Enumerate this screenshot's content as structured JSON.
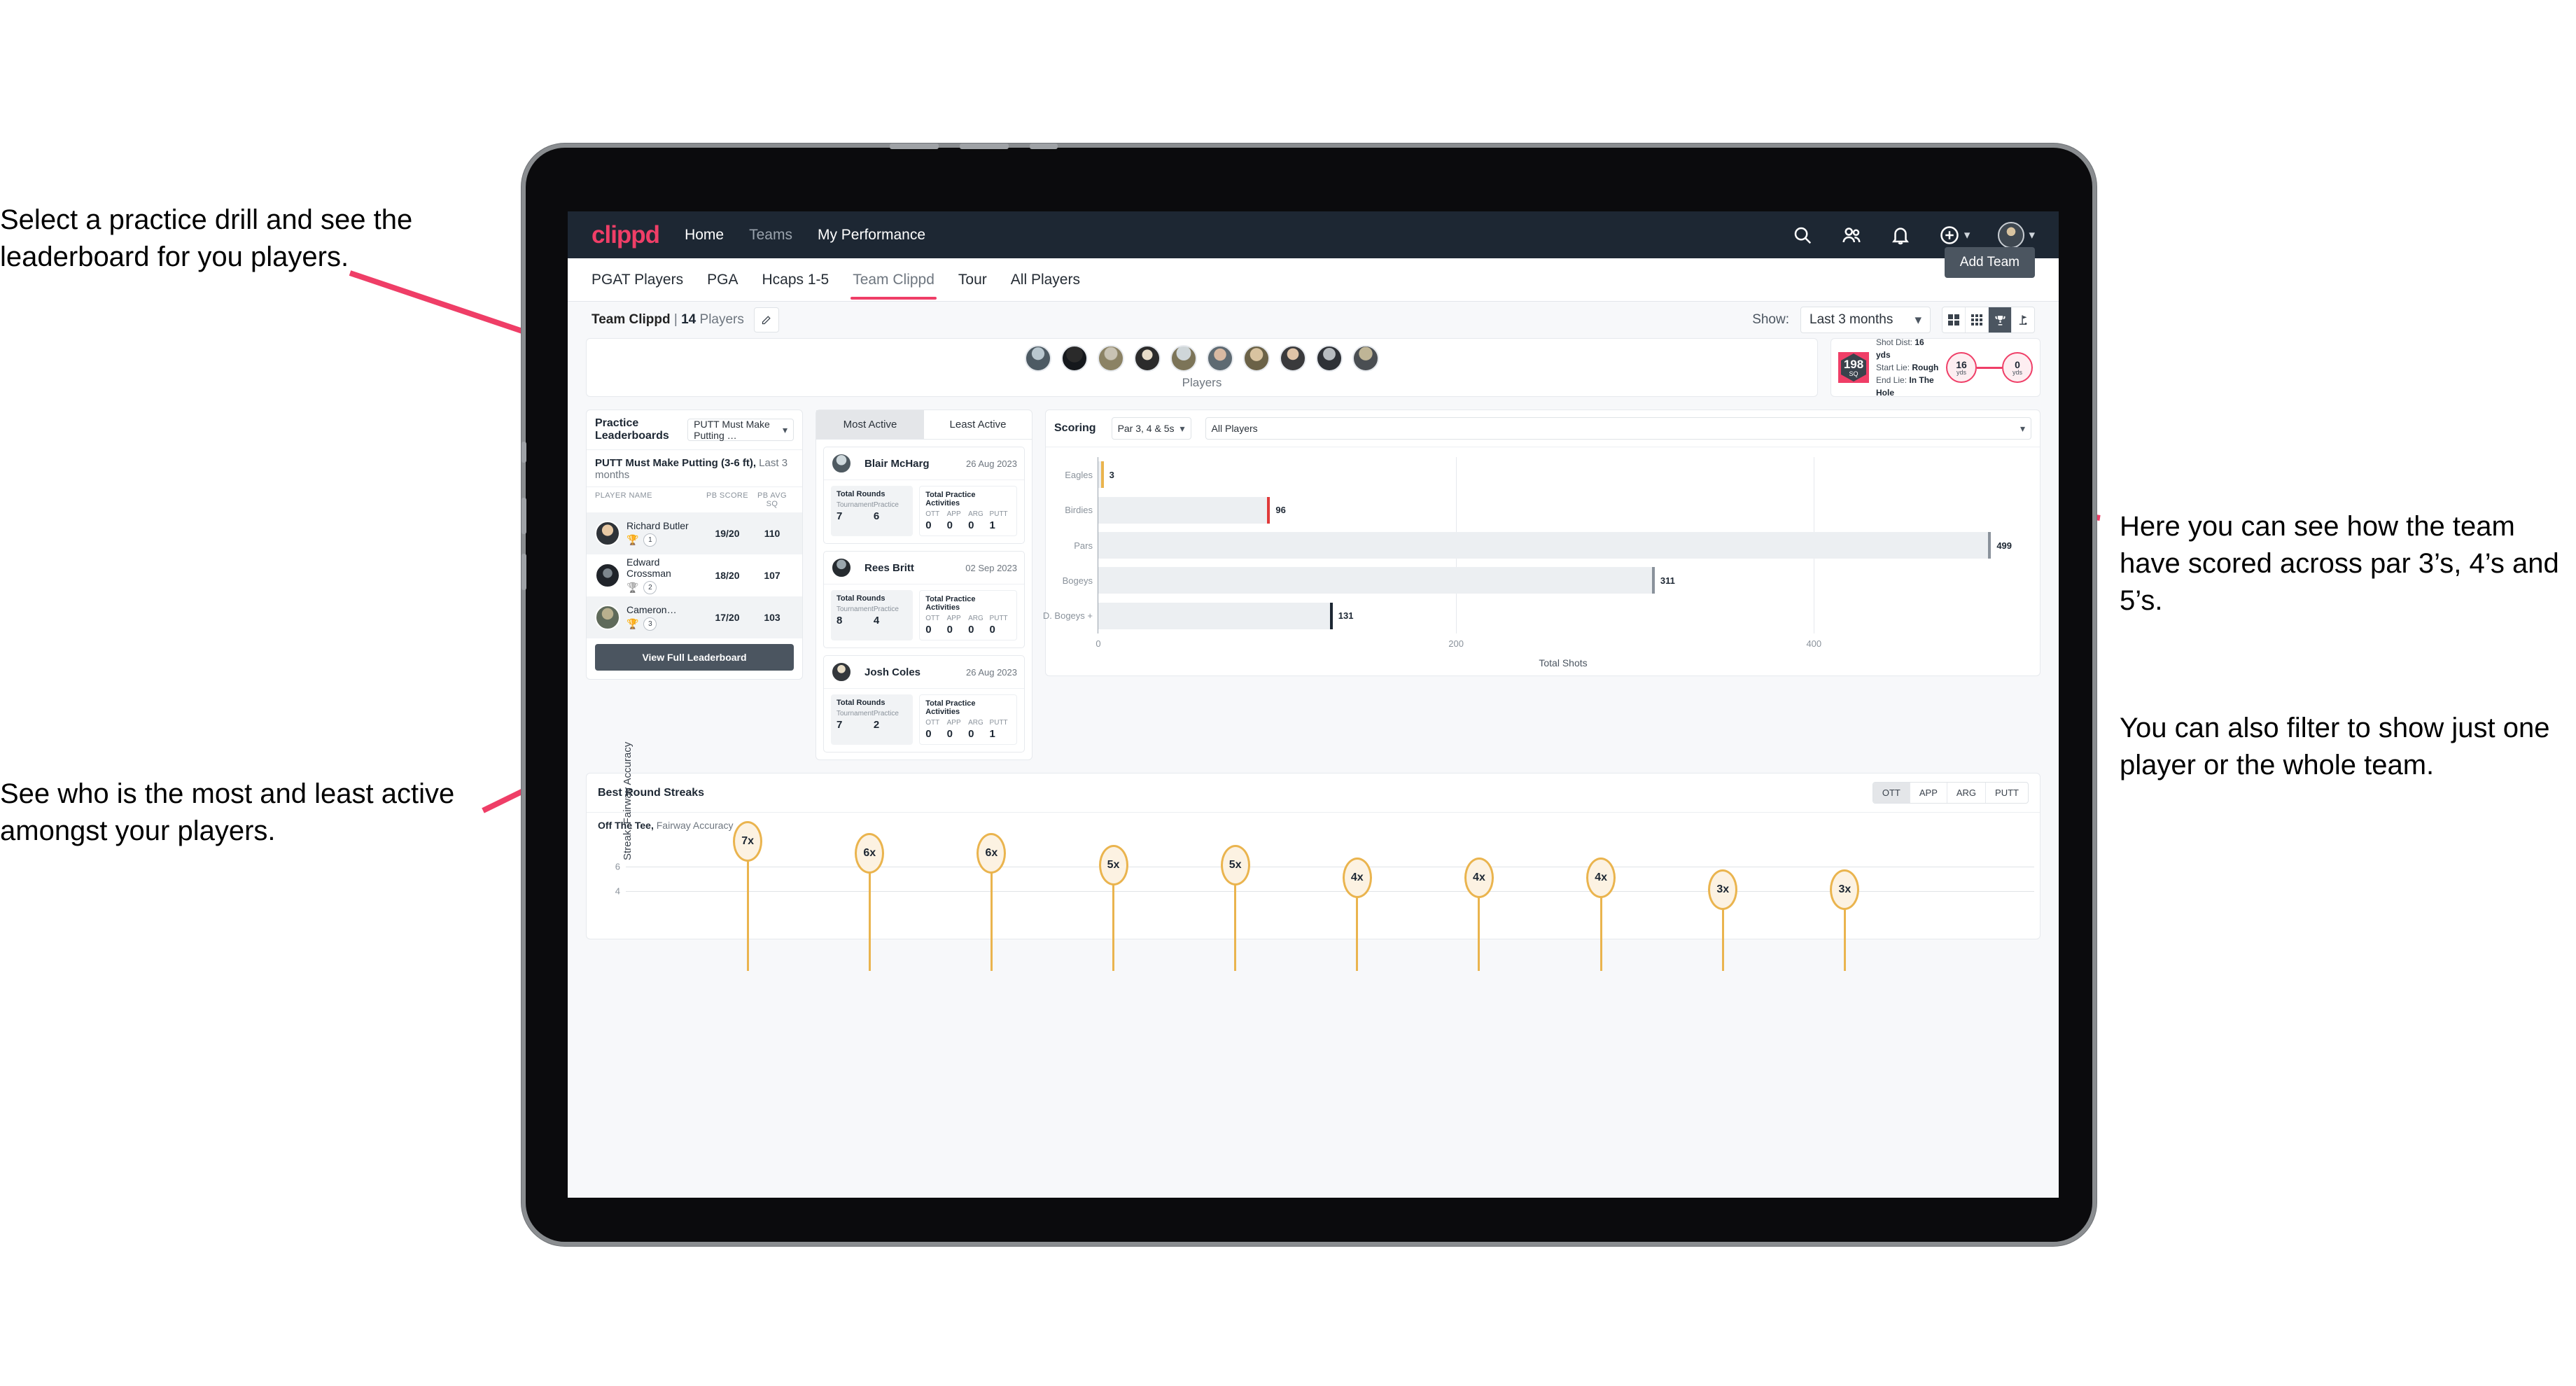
{
  "annotations": {
    "top_left": "Select a practice drill and see the leaderboard for you players.",
    "bottom_left": "See who is the most and least active amongst your players.",
    "right_1": "Here you can see how the team have scored across par 3’s, 4’s and 5’s.",
    "right_2": "You can also filter to show just one player or the whole team."
  },
  "app": {
    "logo": "clippd",
    "nav": [
      {
        "label": "Home",
        "active": true
      },
      {
        "label": "Teams",
        "active": false
      },
      {
        "label": "My Performance",
        "active": true
      }
    ],
    "header_icons": [
      "search-icon",
      "people-icon",
      "bell-icon",
      "plus-circle-icon",
      "avatar"
    ],
    "tabs": [
      {
        "label": "PGAT Players",
        "active": false
      },
      {
        "label": "PGA",
        "active": false
      },
      {
        "label": "Hcaps 1-5",
        "active": false
      },
      {
        "label": "Team Clippd",
        "active": true
      },
      {
        "label": "Tour",
        "active": false
      },
      {
        "label": "All Players",
        "active": false
      }
    ],
    "add_team_label": "Add Team",
    "team_name": "Team Clippd",
    "team_separator": " | ",
    "team_players": "14 Players",
    "edit_icon": "pencil-icon",
    "show_label": "Show:",
    "show_value": "Last 3 months",
    "view_buttons": [
      "grid-large-icon",
      "grid-small-icon",
      "trophy-icon",
      "golf-flag-icon"
    ],
    "view_active_index": 2,
    "accent": "#ef3e67",
    "dark": "#1d2733"
  },
  "players_strip": {
    "label": "Players",
    "count": 10
  },
  "shot_card": {
    "sq_value": "198",
    "sq_unit": "SQ",
    "lines": [
      {
        "key": "Shot Dist:",
        "val": "16 yds"
      },
      {
        "key": "Start Lie:",
        "val": "Rough"
      },
      {
        "key": "End Lie:",
        "val": "In The Hole"
      }
    ],
    "start_dist": "16",
    "start_unit": "yds",
    "end_dist": "0",
    "end_unit": "yds"
  },
  "practice_leaderboard": {
    "title": "Practice Leaderboards",
    "drill_select": "PUTT Must Make Putting …",
    "drill_name": "PUTT Must Make Putting (3-6 ft),",
    "drill_period": "Last 3 months",
    "columns": [
      "PLAYER NAME",
      "PB SCORE",
      "PB AVG SQ"
    ],
    "rows": [
      {
        "name": "Richard Butler",
        "rank": "1",
        "trophy": "gold",
        "pb_score": "19/20",
        "pb_avg_sq": "110"
      },
      {
        "name": "Edward Crossman",
        "rank": "2",
        "trophy": "silver",
        "pb_score": "18/20",
        "pb_avg_sq": "107"
      },
      {
        "name": "Cameron…",
        "rank": "3",
        "trophy": "bronze",
        "pb_score": "17/20",
        "pb_avg_sq": "103"
      }
    ],
    "button_label": "View Full Leaderboard"
  },
  "activity": {
    "tabs": [
      {
        "label": "Most Active",
        "active": true
      },
      {
        "label": "Least Active",
        "active": false
      }
    ],
    "rounds_title": "Total Rounds",
    "practice_title": "Total Practice Activities",
    "rounds_keys": [
      "Tournament",
      "Practice"
    ],
    "practice_keys": [
      "OTT",
      "APP",
      "ARG",
      "PUTT"
    ],
    "cards": [
      {
        "name": "Blair McHarg",
        "date": "26 Aug 2023",
        "rounds": [
          "7",
          "6"
        ],
        "practice": [
          "0",
          "0",
          "0",
          "1"
        ]
      },
      {
        "name": "Rees Britt",
        "date": "02 Sep 2023",
        "rounds": [
          "8",
          "4"
        ],
        "practice": [
          "0",
          "0",
          "0",
          "0"
        ]
      },
      {
        "name": "Josh Coles",
        "date": "26 Aug 2023",
        "rounds": [
          "7",
          "2"
        ],
        "practice": [
          "0",
          "0",
          "0",
          "1"
        ]
      }
    ]
  },
  "scoring": {
    "title": "Scoring",
    "par_select": "Par 3, 4 & 5s",
    "player_select": "All Players"
  },
  "streaks": {
    "title": "Best Round Streaks",
    "toggle": [
      {
        "label": "OTT",
        "active": true
      },
      {
        "label": "APP",
        "active": false
      },
      {
        "label": "ARG",
        "active": false
      },
      {
        "label": "PUTT",
        "active": false
      }
    ],
    "subtitle_bold": "Off The Tee,",
    "subtitle_rest": "Fairway Accuracy"
  },
  "chart_data": [
    {
      "type": "bar",
      "orientation": "horizontal",
      "title": "Scoring",
      "categories": [
        "Eagles",
        "Birdies",
        "Pars",
        "Bogeys",
        "D. Bogeys +"
      ],
      "values": [
        3,
        96,
        499,
        311,
        131
      ],
      "cap_colors": [
        "#eab44e",
        "#e03a3a",
        "#8a929b",
        "#8a929b",
        "#1d2733"
      ],
      "xlabel": "Total Shots",
      "ylabel": "",
      "xlim": [
        0,
        520
      ],
      "xticks": [
        0,
        200,
        400
      ],
      "grid": true,
      "legend": "none"
    },
    {
      "type": "bar",
      "orientation": "vertical",
      "title": "Best Round Streaks",
      "subtitle": "Off The Tee, Fairway Accuracy",
      "ylabel": "Streak, Fairway Accuracy",
      "labels": [
        "7x",
        "6x",
        "6x",
        "5x",
        "5x",
        "4x",
        "4x",
        "4x",
        "3x",
        "3x"
      ],
      "values": [
        7,
        6,
        6,
        5,
        5,
        4,
        4,
        4,
        3,
        3
      ],
      "yticks": [
        4,
        6
      ],
      "ylim": [
        0,
        7.6
      ],
      "grid": true,
      "legend": "none",
      "marker_color": "#eab44e"
    }
  ]
}
